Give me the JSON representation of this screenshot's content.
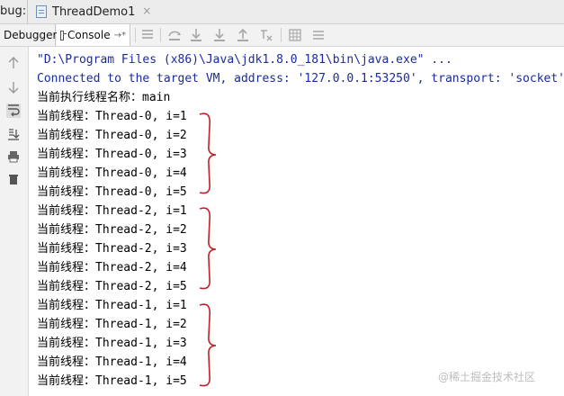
{
  "tabs": {
    "debug_label": "bug:",
    "file_tab_label": "ThreadDemo1",
    "close_glyph": "×"
  },
  "toolbar": {
    "debugger_label": "Debugger",
    "console_label": "Console",
    "console_suffix": "→*"
  },
  "console": {
    "lines": [
      {
        "text": "\"D:\\Program Files (x86)\\Java\\jdk1.8.0_181\\bin\\java.exe\" ...",
        "kind": "cmd"
      },
      {
        "text": "Connected to the target VM, address: '127.0.0.1:53250', transport: 'socket'",
        "kind": "connect"
      },
      {
        "text": "当前执行线程名称：main",
        "kind": "out"
      },
      {
        "text": "当前线程：Thread-0, i=1",
        "kind": "out"
      },
      {
        "text": "当前线程：Thread-0, i=2",
        "kind": "out"
      },
      {
        "text": "当前线程：Thread-0, i=3",
        "kind": "out"
      },
      {
        "text": "当前线程：Thread-0, i=4",
        "kind": "out"
      },
      {
        "text": "当前线程：Thread-0, i=5",
        "kind": "out"
      },
      {
        "text": "当前线程：Thread-2, i=1",
        "kind": "out"
      },
      {
        "text": "当前线程：Thread-2, i=2",
        "kind": "out"
      },
      {
        "text": "当前线程：Thread-2, i=3",
        "kind": "out"
      },
      {
        "text": "当前线程：Thread-2, i=4",
        "kind": "out"
      },
      {
        "text": "当前线程：Thread-2, i=5",
        "kind": "out"
      },
      {
        "text": "当前线程：Thread-1, i=1",
        "kind": "out"
      },
      {
        "text": "当前线程：Thread-1, i=2",
        "kind": "out"
      },
      {
        "text": "当前线程：Thread-1, i=3",
        "kind": "out"
      },
      {
        "text": "当前线程：Thread-1, i=4",
        "kind": "out"
      },
      {
        "text": "当前线程：Thread-1, i=5",
        "kind": "out"
      }
    ]
  },
  "annotation": {
    "brace_color": "#c0202a"
  },
  "watermark": "@稀土掘金技术社区"
}
